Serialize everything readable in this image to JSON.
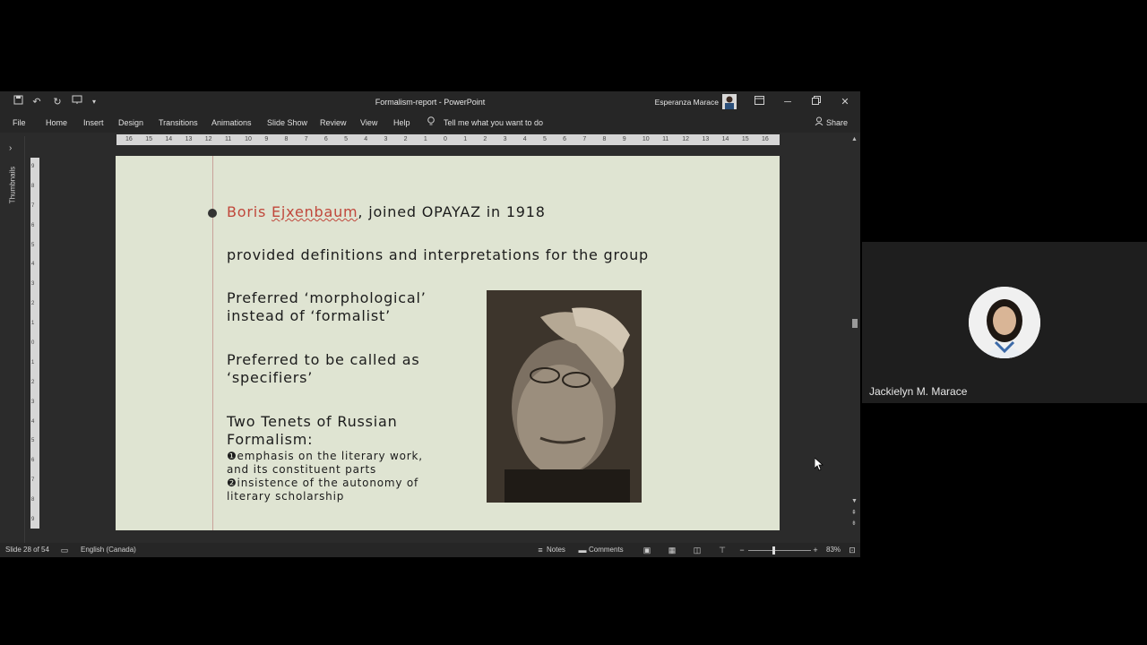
{
  "window": {
    "title": "Formalism-report  -  PowerPoint",
    "user_name": "Esperanza Marace"
  },
  "ribbon": {
    "tabs": [
      "File",
      "Home",
      "Insert",
      "Design",
      "Transitions",
      "Animations",
      "Slide Show",
      "Review",
      "View",
      "Help"
    ],
    "tell_me": "Tell me what you want to do",
    "share": "Share"
  },
  "left_panel": {
    "label": "Thumbnails"
  },
  "ruler": {
    "marks": [
      "16",
      "15",
      "14",
      "13",
      "12",
      "11",
      "10",
      "9",
      "8",
      "7",
      "6",
      "5",
      "4",
      "3",
      "2",
      "1",
      "0",
      "1",
      "2",
      "3",
      "4",
      "5",
      "6",
      "7",
      "8",
      "9",
      "10",
      "11",
      "12",
      "13",
      "14",
      "15",
      "16"
    ]
  },
  "vertical_ruler": {
    "marks": [
      "9",
      "8",
      "7",
      "6",
      "5",
      "4",
      "3",
      "2",
      "1",
      "0",
      "1",
      "2",
      "3",
      "4",
      "5",
      "6",
      "7",
      "8",
      "9"
    ]
  },
  "slide": {
    "bullet_name": "Boris",
    "bullet_surname": "Ejxenbaum",
    "bullet_rest": ", joined OPAYAZ in 1918",
    "line2": "provided definitions and interpretations for the group",
    "line3a": "Preferred ‘morphological’",
    "line3b": "instead of ‘formalist’",
    "line4a": "Preferred to be called as",
    "line4b": "‘specifiers’",
    "line5a": "Two Tenets of Russian",
    "line5b": "Formalism:",
    "tenet1a": "❶emphasis on the literary work,",
    "tenet1b": "and its constituent parts",
    "tenet2a": "❷insistence of the autonomy of",
    "tenet2b": "literary scholarship"
  },
  "status_bar": {
    "slide_info": "Slide 28 of 54",
    "language": "English (Canada)",
    "notes": "Notes",
    "comments": "Comments",
    "zoom": "83%"
  },
  "participant": {
    "name": "Jackielyn M. Marace"
  },
  "colors": {
    "slide_bg": "#dfe4d2",
    "accent_red": "#c0473b",
    "window_bg": "#2b2b2b"
  }
}
